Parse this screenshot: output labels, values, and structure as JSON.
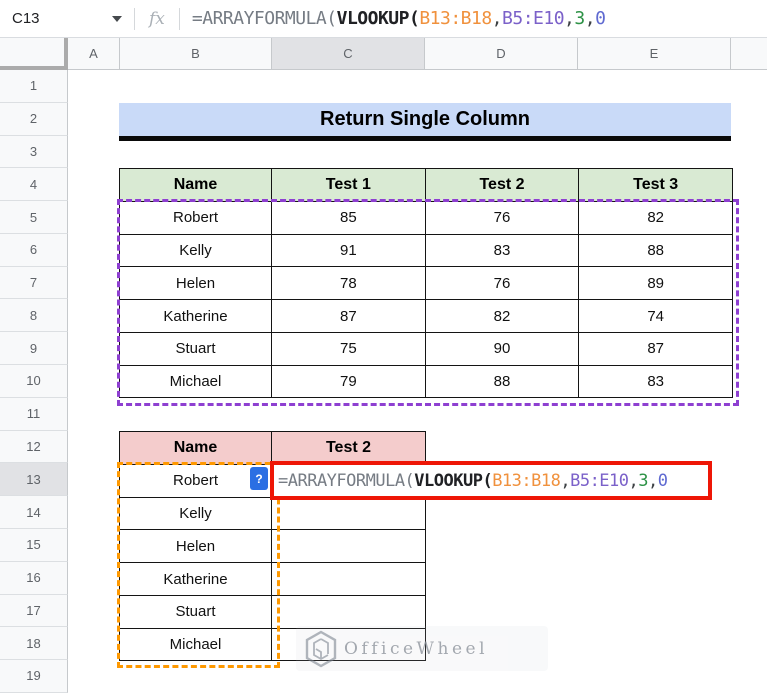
{
  "formula_bar": {
    "cell_reference": "C13",
    "fx_label": "fx"
  },
  "formula": {
    "segments": [
      {
        "text": "=ARRAYFORMULA(",
        "role": "plainlight"
      },
      {
        "text": "VLOOKUP(",
        "role": "func"
      },
      {
        "text": "B13:B18",
        "role": "range1"
      },
      {
        "text": ",",
        "role": "plain"
      },
      {
        "text": "B5:E10",
        "role": "range2"
      },
      {
        "text": ",",
        "role": "plain"
      },
      {
        "text": "3",
        "role": "num1"
      },
      {
        "text": ",",
        "role": "plain"
      },
      {
        "text": "0",
        "role": "num2"
      }
    ]
  },
  "grid": {
    "column_letters": [
      "A",
      "B",
      "C",
      "D",
      "E"
    ],
    "row_numbers": [
      1,
      2,
      3,
      4,
      5,
      6,
      7,
      8,
      9,
      10,
      11,
      12,
      13,
      14,
      15,
      16,
      17,
      18,
      19
    ],
    "selected_column": "C",
    "selected_row": 13
  },
  "title": {
    "text": "Return Single Column"
  },
  "table1": {
    "headers": [
      "Name",
      "Test 1",
      "Test 2",
      "Test 3"
    ],
    "rows": [
      [
        "Robert",
        85,
        76,
        82
      ],
      [
        "Kelly",
        91,
        83,
        88
      ],
      [
        "Helen",
        78,
        76,
        89
      ],
      [
        "Katherine",
        87,
        82,
        74
      ],
      [
        "Stuart",
        75,
        90,
        87
      ],
      [
        "Michael",
        79,
        88,
        83
      ]
    ]
  },
  "table2": {
    "headers": [
      "Name",
      "Test 2"
    ],
    "names": [
      "Robert",
      "Kelly",
      "Helen",
      "Katherine",
      "Stuart",
      "Michael"
    ]
  },
  "help_badge": "?",
  "watermark": {
    "text": "OfficeWheel"
  },
  "colors": {
    "title_bg": "#c9daf8",
    "t1_header": "#d9ead3",
    "t2_header": "#f4cccc",
    "range1_text": "#f0913d",
    "range1_dash": "#ff9900",
    "range2_text": "#7b61c9",
    "range2_dash": "#8e3fd1",
    "num1_text": "#2d9246",
    "num2_text": "#5f6ad1",
    "func_text": "#202124",
    "plain_light_text": "#767c84",
    "red_border": "#ee1606",
    "badge_bg": "#2b6fe3"
  }
}
